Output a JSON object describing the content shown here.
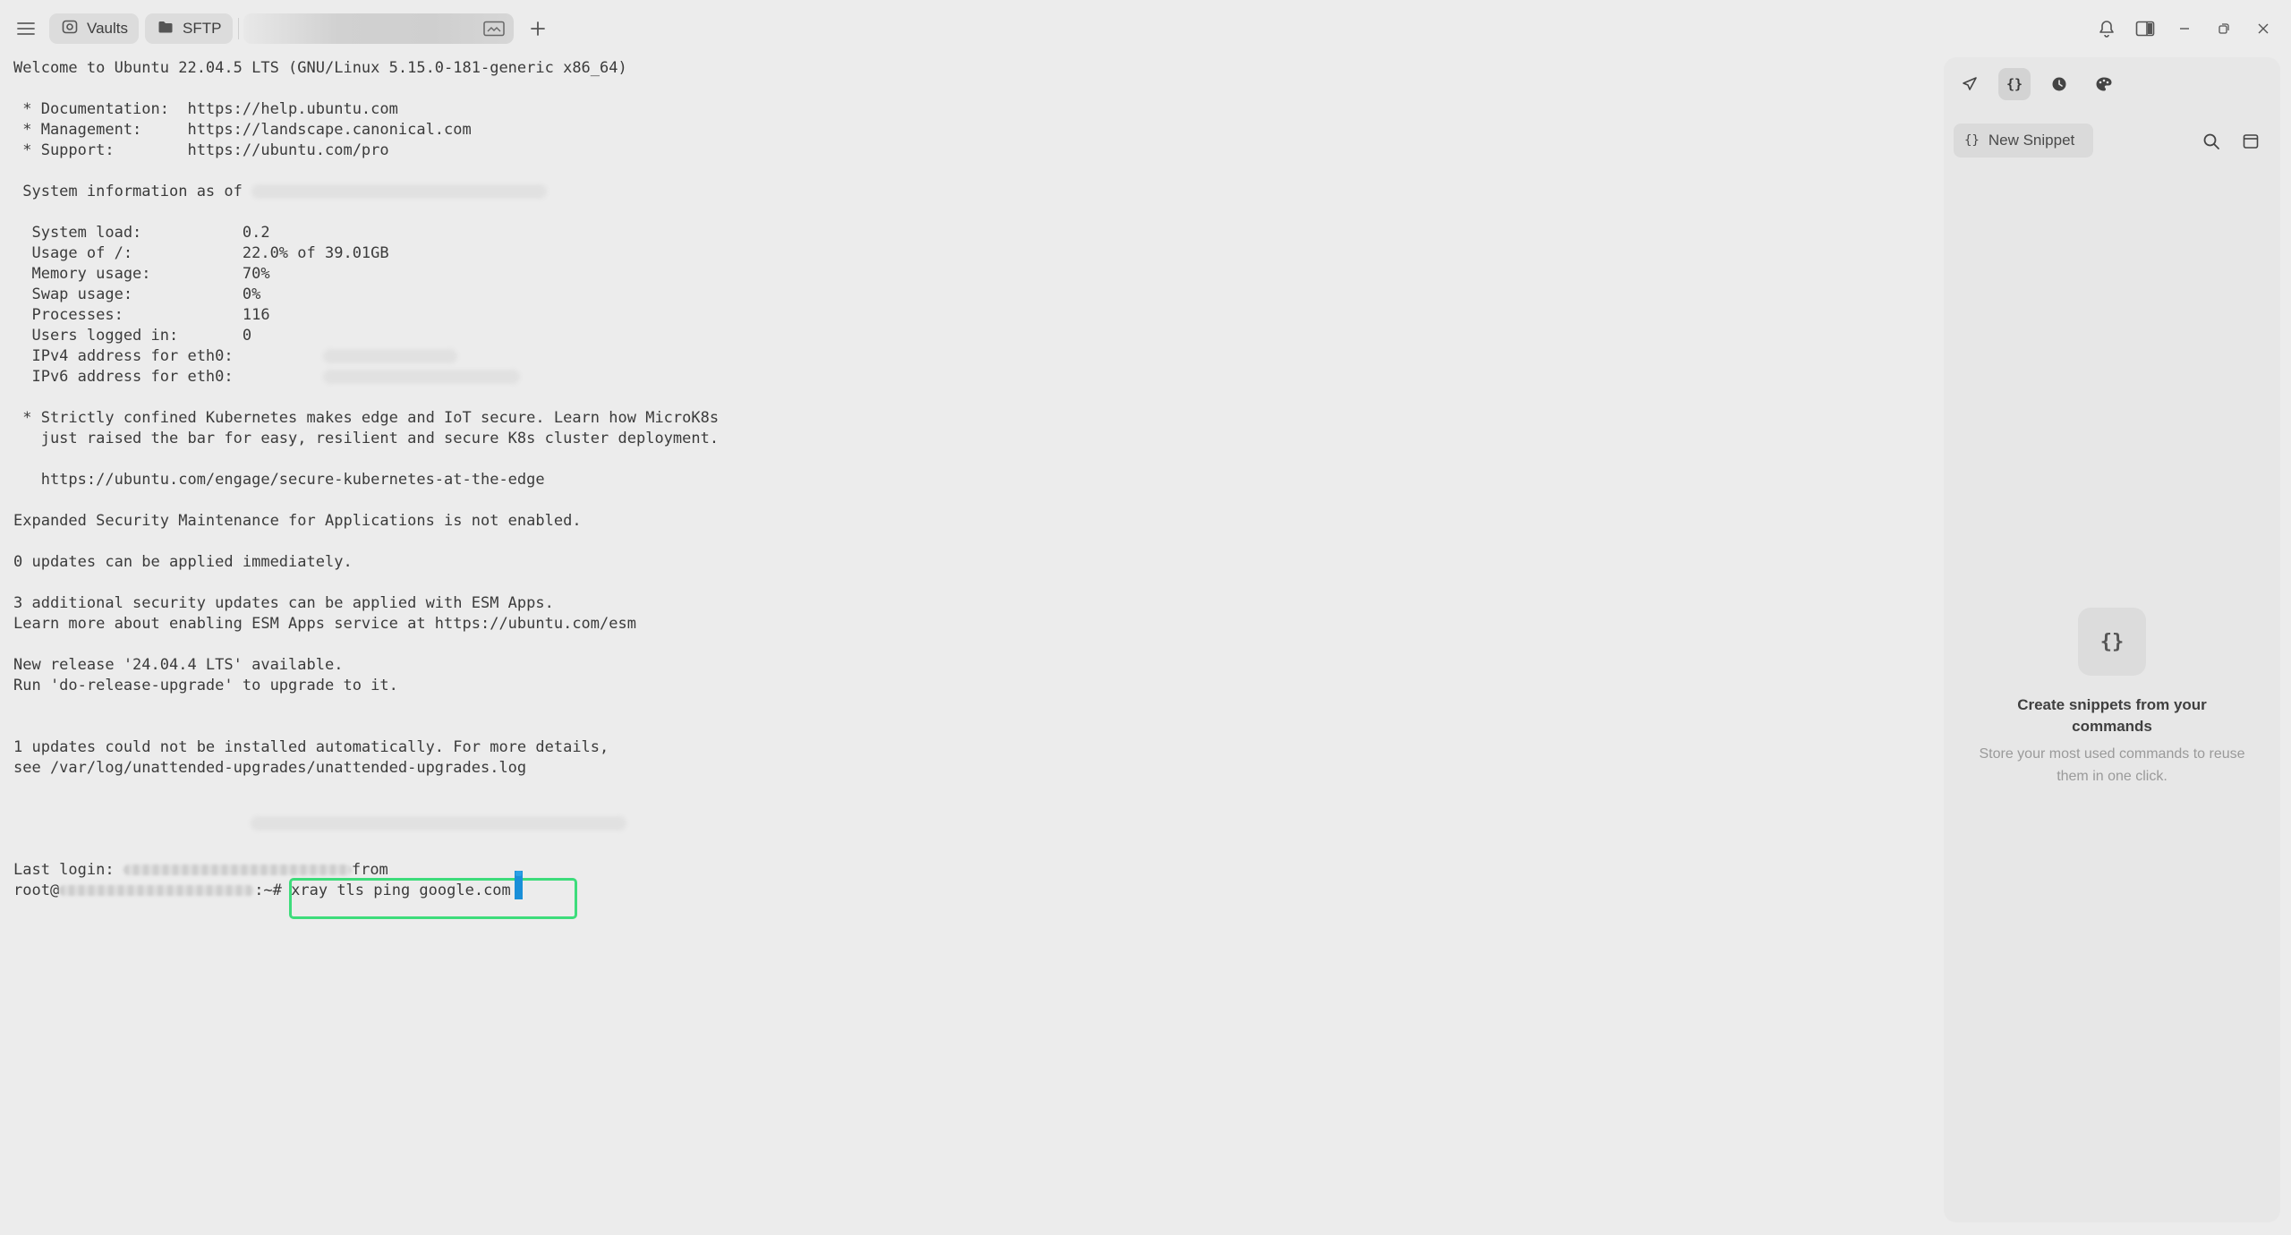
{
  "topbar": {
    "menu_icon": "hamburger-icon",
    "tabs": [
      {
        "label": "Vaults",
        "icon": "vault-icon"
      },
      {
        "label": "SFTP",
        "icon": "folder-icon"
      }
    ],
    "host_tab_icon": "terminal-image-icon",
    "add_tab_icon": "plus-icon",
    "right_icons": [
      "bell-icon",
      "panel-toggle-icon",
      "minimize-icon",
      "restore-icon",
      "close-icon"
    ]
  },
  "terminal": {
    "welcome": "Welcome to Ubuntu 22.04.5 LTS (GNU/Linux 5.15.0-181-generic x86_64)",
    "doc_line": " * Documentation:  https://help.ubuntu.com",
    "mgmt_line": " * Management:     https://landscape.canonical.com",
    "support_line": " * Support:        https://ubuntu.com/pro",
    "sysinfo_prefix": " System information as of",
    "sys_load": "  System load:           0.2",
    "usage": "  Usage of /:            22.0% of 39.01GB",
    "memory": "  Memory usage:          70%",
    "swap": "  Swap usage:            0%",
    "processes": "  Processes:             116",
    "users": "  Users logged in:       0",
    "ipv4": "  IPv4 address for eth0:",
    "ipv6": "  IPv6 address for eth0:",
    "k8s_1": " * Strictly confined Kubernetes makes edge and IoT secure. Learn how MicroK8s",
    "k8s_2": "   just raised the bar for easy, resilient and secure K8s cluster deployment.",
    "k8s_url": "   https://ubuntu.com/engage/secure-kubernetes-at-the-edge",
    "esm": "Expanded Security Maintenance for Applications is not enabled.",
    "updates_now": "0 updates can be applied immediately.",
    "esm_updates": "3 additional security updates can be applied with ESM Apps.",
    "esm_learn": "Learn more about enabling ESM Apps service at https://ubuntu.com/esm",
    "new_release": "New release '24.04.4 LTS' available.",
    "release_upgrade": "Run 'do-release-upgrade' to upgrade to it.",
    "unattended_1": "1 updates could not be installed automatically. For more details,",
    "unattended_2": "see /var/log/unattended-upgrades/unattended-upgrades.log",
    "last_login_prefix": "Last login:",
    "last_login_from": "from",
    "prompt_prefix": "root@",
    "prompt_suffix": ":~#",
    "command": " xray tls ping google.com"
  },
  "snippets_panel": {
    "tab_icons": [
      "send-icon",
      "snippets-icon",
      "history-icon",
      "palette-icon"
    ],
    "tab_snip_glyph": "{}",
    "new_snippet_glyph": "{}",
    "new_snippet_label": "New Snippet",
    "search_icon": "search-icon",
    "layout_icon": "layout-icon",
    "empty_glyph": "{}",
    "empty_title": "Create snippets from your commands",
    "empty_subtitle": "Store your most used commands to reuse them in one click."
  },
  "colors": {
    "background": "#ececec",
    "panel": "#e7e7e7",
    "highlight": "#3ddc7b",
    "cursor": "#1a8fd8"
  }
}
